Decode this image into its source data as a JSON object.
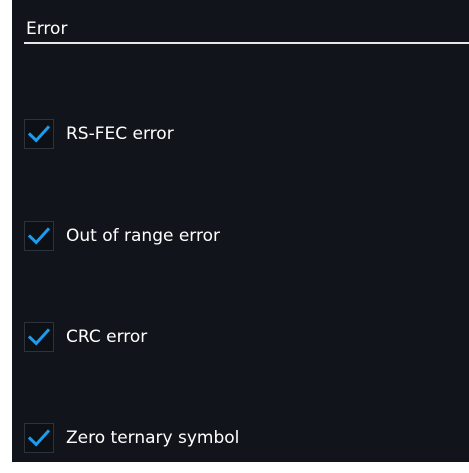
{
  "section": {
    "title": "Error"
  },
  "options": [
    {
      "label": "RS-FEC error",
      "checked": true
    },
    {
      "label": "Out of range error",
      "checked": true
    },
    {
      "label": "CRC error",
      "checked": true
    },
    {
      "label": "Zero ternary symbol",
      "checked": true
    }
  ],
  "colors": {
    "background": "#11151b",
    "checkmark": "#1c9bf0",
    "text": "#ffffff",
    "rule": "#e8e8e8"
  },
  "icons": {
    "checkbox": "checkmark-icon"
  }
}
